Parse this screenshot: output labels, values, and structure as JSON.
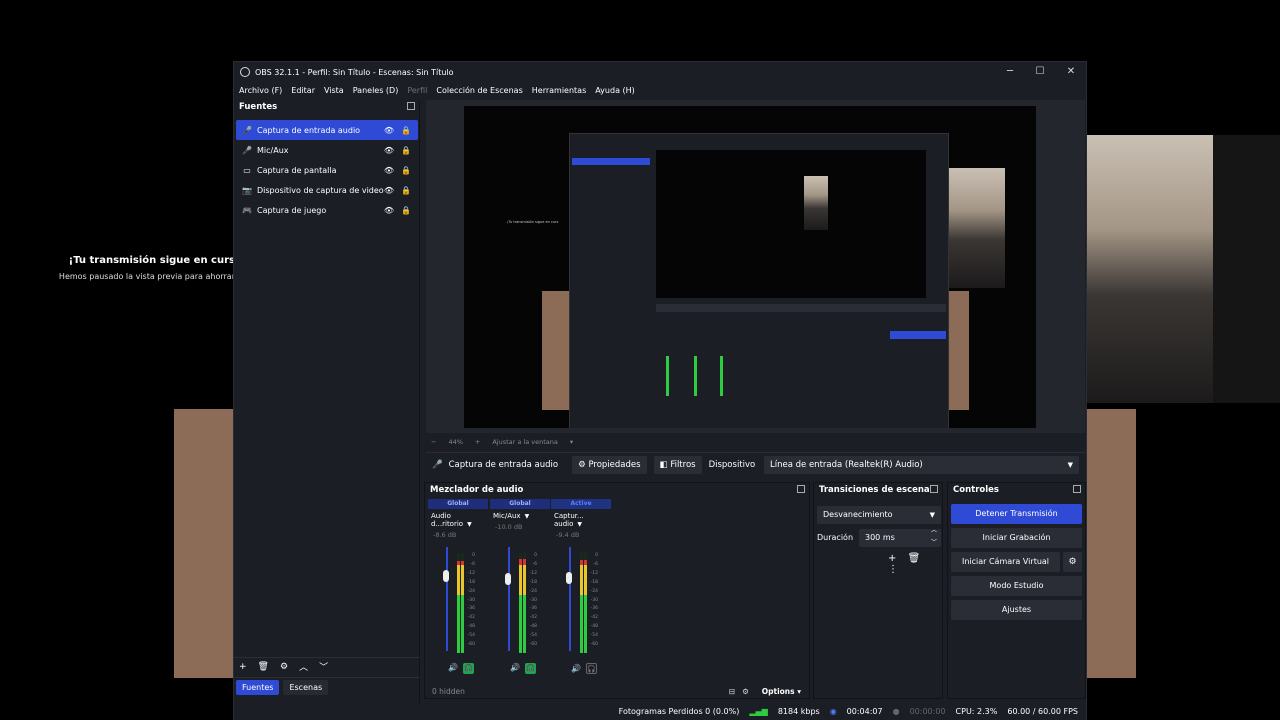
{
  "window": {
    "title": "OBS 32.1.1 - Perfil: Sin Título - Escenas: Sin Título",
    "minimize": "─",
    "maximize": "☐",
    "close": "✕"
  },
  "menu": {
    "items": [
      "Archivo (F)",
      "Editar",
      "Vista",
      "Paneles (D)",
      "Perfil",
      "Colección de Escenas",
      "Herramientas",
      "Ayuda (H)"
    ]
  },
  "background": {
    "paused_title": "¡Tu transmisión sigue en curs",
    "paused_sub": "Hemos pausado la vista previa para ahorrar"
  },
  "sources": {
    "title": "Fuentes",
    "items": [
      {
        "label": "Captura de entrada audio",
        "icon": "microphone-icon",
        "glyph": "🎤"
      },
      {
        "label": "Mic/Aux",
        "icon": "microphone-icon",
        "glyph": "🎤"
      },
      {
        "label": "Captura de pantalla",
        "icon": "monitor-icon",
        "glyph": "▭"
      },
      {
        "label": "Dispositivo de captura de video",
        "icon": "camera-icon",
        "glyph": "📷"
      },
      {
        "label": "Captura de juego",
        "icon": "gamepad-icon",
        "glyph": "🎮"
      }
    ],
    "toolbar": [
      "+",
      "🗑",
      "⚙",
      "︿",
      "﹀"
    ]
  },
  "tabs": {
    "sources": "Fuentes",
    "scenes": "Escenas"
  },
  "preview": {
    "zoom": "44%",
    "zoom_minus": "−",
    "zoom_plus": "+",
    "fit": "Ajustar a la ventana"
  },
  "context": {
    "source": "Captura de entrada audio",
    "properties": "Propiedades",
    "filters": "Filtros",
    "device_label": "Dispositivo",
    "device_value": "Línea de entrada (Realtek(R) Audio)"
  },
  "mixer": {
    "title": "Mezclador de audio",
    "scale": [
      "0",
      "-6",
      "-12",
      "-18",
      "-24",
      "-30",
      "-36",
      "-42",
      "-48",
      "-54",
      "-60"
    ],
    "channels": [
      {
        "tag": "Global",
        "name": "Audio d...ritorio",
        "db": "-8.6 dB",
        "level": 0.92,
        "volume": 0.78
      },
      {
        "tag": "Global",
        "name": "Mic/Aux",
        "db": "-10.0 dB",
        "level": 0.94,
        "volume": 0.75
      },
      {
        "tag": "Active",
        "name": "Captur... audio",
        "db": "-9.4 dB",
        "level": 0.93,
        "volume": 0.76
      }
    ],
    "hidden": "0 hidden",
    "options": "Options"
  },
  "transitions": {
    "title": "Transiciones de escena",
    "selected": "Desvanecimiento",
    "duration_label": "Duración",
    "duration_value": "300 ms"
  },
  "controls": {
    "title": "Controles",
    "stop_stream": "Detener Transmisión",
    "start_recording": "Iniciar Grabación",
    "start_virtual_cam": "Iniciar Cámara Virtual",
    "studio_mode": "Modo Estudio",
    "settings": "Ajustes"
  },
  "status": {
    "dropped_frames": "Fotogramas Perdidos 0 (0.0%)",
    "bitrate": "8184 kbps",
    "stream_time": "00:04:07",
    "record_time": "00:00:00",
    "cpu": "CPU: 2.3%",
    "fps": "60.00 / 60.00 FPS"
  },
  "colors": {
    "accent": "#2f4bd6",
    "panel": "#1c1e26",
    "meter_green": "#2ecc40",
    "meter_yellow": "#e8c62a",
    "meter_red": "#d63333"
  }
}
